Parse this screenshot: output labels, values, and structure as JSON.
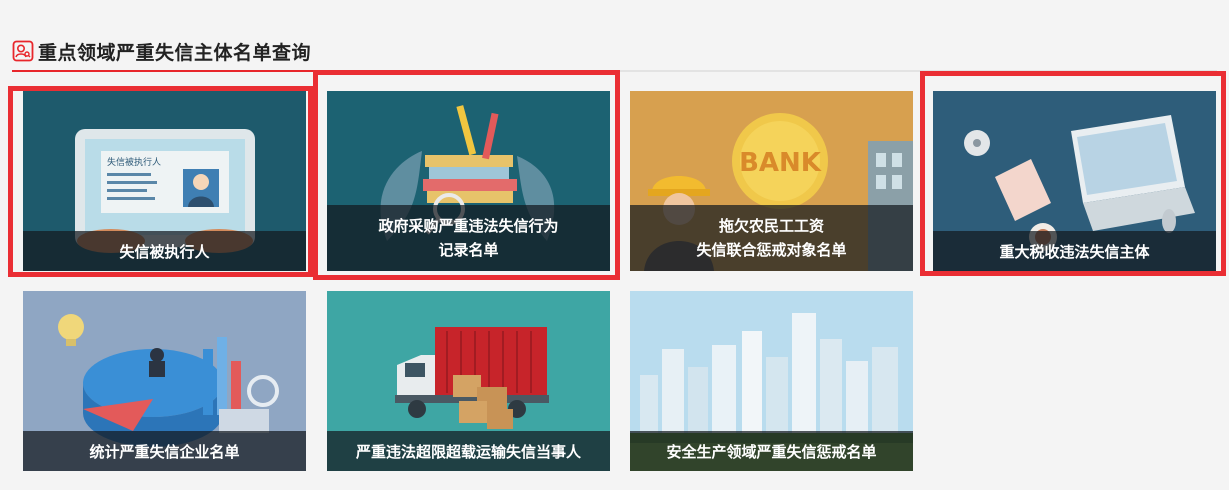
{
  "section": {
    "title": "重点领域严重失信主体名单查询",
    "icon": "person-search-icon",
    "accent_color": "#e8262b"
  },
  "cards": [
    {
      "name": "card-dishonest-executed",
      "caption": "失信被执行人",
      "inner_label": "失信被执行人",
      "highlighted": true
    },
    {
      "name": "card-gov-procurement",
      "caption_lines": [
        "政府采购严重违法失信行为",
        "记录名单"
      ],
      "highlighted": true
    },
    {
      "name": "card-migrant-wages",
      "caption_lines": [
        "拖欠农民工工资",
        "失信联合惩戒对象名单"
      ],
      "bank_sign": "BANK",
      "highlighted": false
    },
    {
      "name": "card-tax-violation",
      "caption": "重大税收违法失信主体",
      "highlighted": true
    },
    {
      "name": "card-statistics",
      "caption": "统计严重失信企业名单",
      "highlighted": false
    },
    {
      "name": "card-overload-transport",
      "caption": "严重违法超限超载运输失信当事人",
      "highlighted": false
    },
    {
      "name": "card-safety-production",
      "caption": "安全生产领域严重失信惩戒名单",
      "highlighted": false
    }
  ],
  "colors": {
    "highlight_border": "#ea2e34",
    "caption_bg": "rgba(20,25,30,0.72)"
  }
}
